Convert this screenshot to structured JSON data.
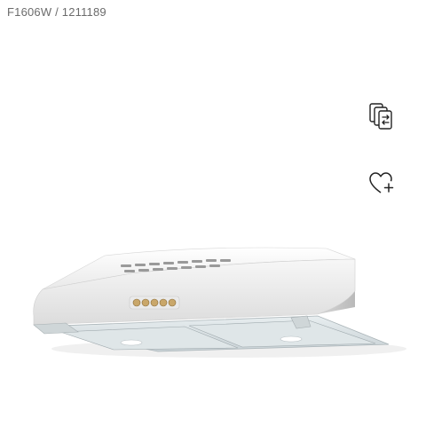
{
  "product": {
    "sku_text": "F1606W / 1211189",
    "image_alt": "White under-cabinet cooker hood with five push buttons"
  },
  "actions": {
    "compare_icon": "compare-icon",
    "wishlist_icon": "heart-plus-icon"
  },
  "colors": {
    "sku_text": "#6b6b6b",
    "icon_stroke": "#222222",
    "product_body": "#f4f4f4",
    "button_gold": "#c9a76a"
  }
}
